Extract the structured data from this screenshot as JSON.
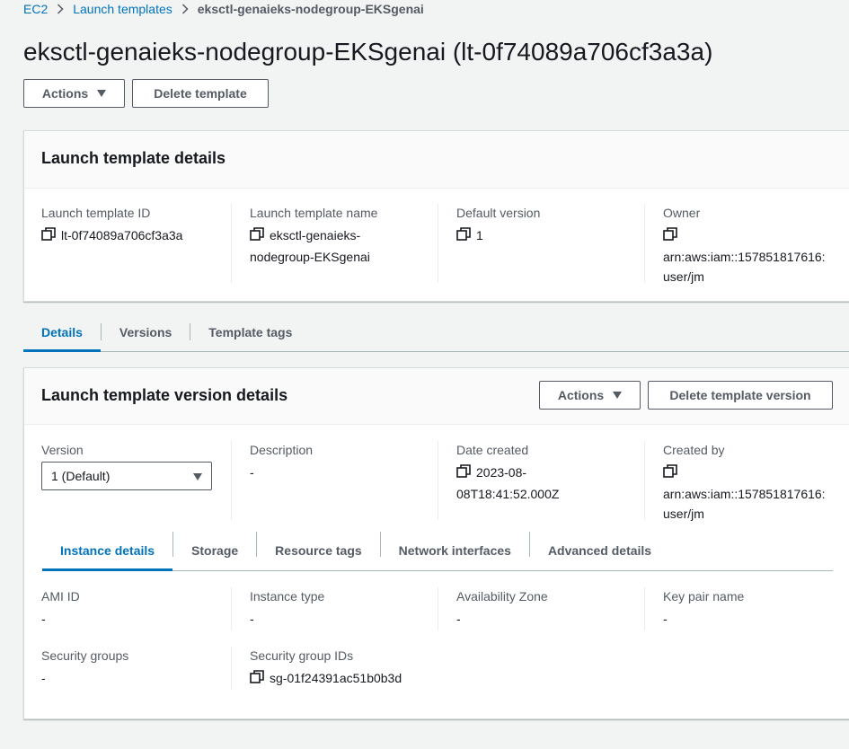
{
  "breadcrumb": {
    "items": [
      "EC2",
      "Launch templates"
    ],
    "current": "eksctl-genaieks-nodegroup-EKSgenai"
  },
  "page": {
    "title": "eksctl-genaieks-nodegroup-EKSgenai (lt-0f74089a706cf3a3a)"
  },
  "top_actions": {
    "actions_label": "Actions",
    "delete_label": "Delete template"
  },
  "details_panel": {
    "title": "Launch template details",
    "fields": [
      {
        "label": "Launch template ID",
        "value": "lt-0f74089a706cf3a3a",
        "copy": true
      },
      {
        "label": "Launch template name",
        "value_lines": [
          "eksctl-genaieks-",
          "nodegroup-EKSgenai"
        ],
        "copy": true
      },
      {
        "label": "Default version",
        "value": "1",
        "copy": true
      },
      {
        "label": "Owner",
        "value_lines": [
          "arn:aws:iam::157851817616:",
          "user/jm"
        ],
        "copy": true
      }
    ]
  },
  "main_tabs": [
    "Details",
    "Versions",
    "Template tags"
  ],
  "version_panel": {
    "title": "Launch template version details",
    "actions_label": "Actions",
    "delete_label": "Delete template version",
    "version": {
      "label": "Version",
      "selected": "1 (Default)"
    },
    "description": {
      "label": "Description",
      "value": "-"
    },
    "date_created": {
      "label": "Date created",
      "value_lines": [
        "2023-08-",
        "08T18:41:52.000Z"
      ]
    },
    "created_by": {
      "label": "Created by",
      "value_lines": [
        "arn:aws:iam::157851817616:",
        "user/jm"
      ]
    },
    "sub_tabs": [
      "Instance details",
      "Storage",
      "Resource tags",
      "Network interfaces",
      "Advanced details"
    ],
    "instance": {
      "ami_id": {
        "label": "AMI ID",
        "value": "-"
      },
      "instance_type": {
        "label": "Instance type",
        "value": "-"
      },
      "availability_zone": {
        "label": "Availability Zone",
        "value": "-"
      },
      "key_pair": {
        "label": "Key pair name",
        "value": "-"
      },
      "security_groups": {
        "label": "Security groups",
        "value": "-"
      },
      "security_group_ids": {
        "label": "Security group IDs",
        "value": "sg-01f24391ac51b0b3d"
      }
    }
  },
  "colors": {
    "link": "#0073bb",
    "text": "#16191f",
    "muted": "#545b64",
    "background": "#f2f3f3"
  }
}
